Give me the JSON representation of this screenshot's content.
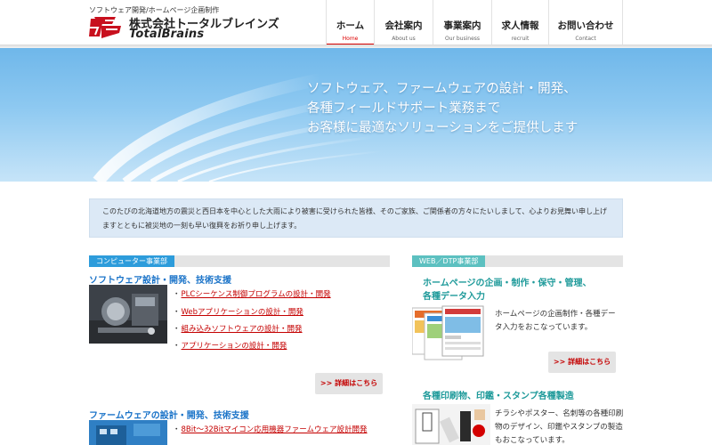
{
  "header": {
    "tagline": "ソフトウェア開発/ホームページ企画制作",
    "company_jp": "株式会社トータルブレインズ",
    "company_en": "TotalBrains",
    "nav": [
      {
        "jp": "ホーム",
        "en": "Home",
        "active": true
      },
      {
        "jp": "会社案内",
        "en": "About us",
        "active": false
      },
      {
        "jp": "事業案内",
        "en": "Our business",
        "active": false
      },
      {
        "jp": "求人情報",
        "en": "recruit",
        "active": false
      },
      {
        "jp": "お問い合わせ",
        "en": "Contact",
        "active": false
      }
    ]
  },
  "hero": {
    "line1": "ソフトウェア、ファームウェアの設計・開発、",
    "line2": "各種フィールドサポート業務まで",
    "line3": "お客様に最適なソリューションをご提供します"
  },
  "notice": {
    "line1": "このたびの北海道地方の震災と西日本を中心とした大雨により被害に受けられた皆様、そのご家族、ご関係者の方々にたいしまして、心よりお見舞い申し上げ",
    "line2": "ますとともに被災地の一刻も早い復興をお祈り申し上げます。"
  },
  "computer": {
    "tab": "コンピューター事業部",
    "software_title": "ソフトウェア設計・開発、技術支援",
    "software_links": [
      "PLCシーケンス制御プログラムの設計・開発",
      "Webアプリケーションの設計・開発",
      "組み込みソフトウェアの設計・開発",
      "アプリケーションの設計・開発"
    ],
    "more_label": ">> 詳細はこちら",
    "firmware_title": "ファームウェアの設計・開発、技術支援",
    "firmware_links": [
      "8Bit～32Bitマイコン応用機器ファームウェア設計開発"
    ]
  },
  "web": {
    "tab": "WEB／DTP事業部",
    "hp_title_1": "ホームページの企画・制作・保守・管理、",
    "hp_title_2": "各種データ入力",
    "hp_desc_1": "ホームページの企画制作・各種デー",
    "hp_desc_2": "タ入力をおこなっています。",
    "more_label": ">> 詳細はこちら",
    "print_title": "各種印刷物、印鑑・スタンプ各種製造",
    "print_desc_1": "チラシやポスター、名刺等の各種印刷",
    "print_desc_2": "物のデザイン、印鑑やスタンプの製造",
    "print_desc_3": "もおこなっています。"
  },
  "colors": {
    "accent_red": "#d40000",
    "computer_blue": "#2d9cdb",
    "web_teal": "#5cc0c0",
    "hero_blue": "#6fb7ea"
  }
}
